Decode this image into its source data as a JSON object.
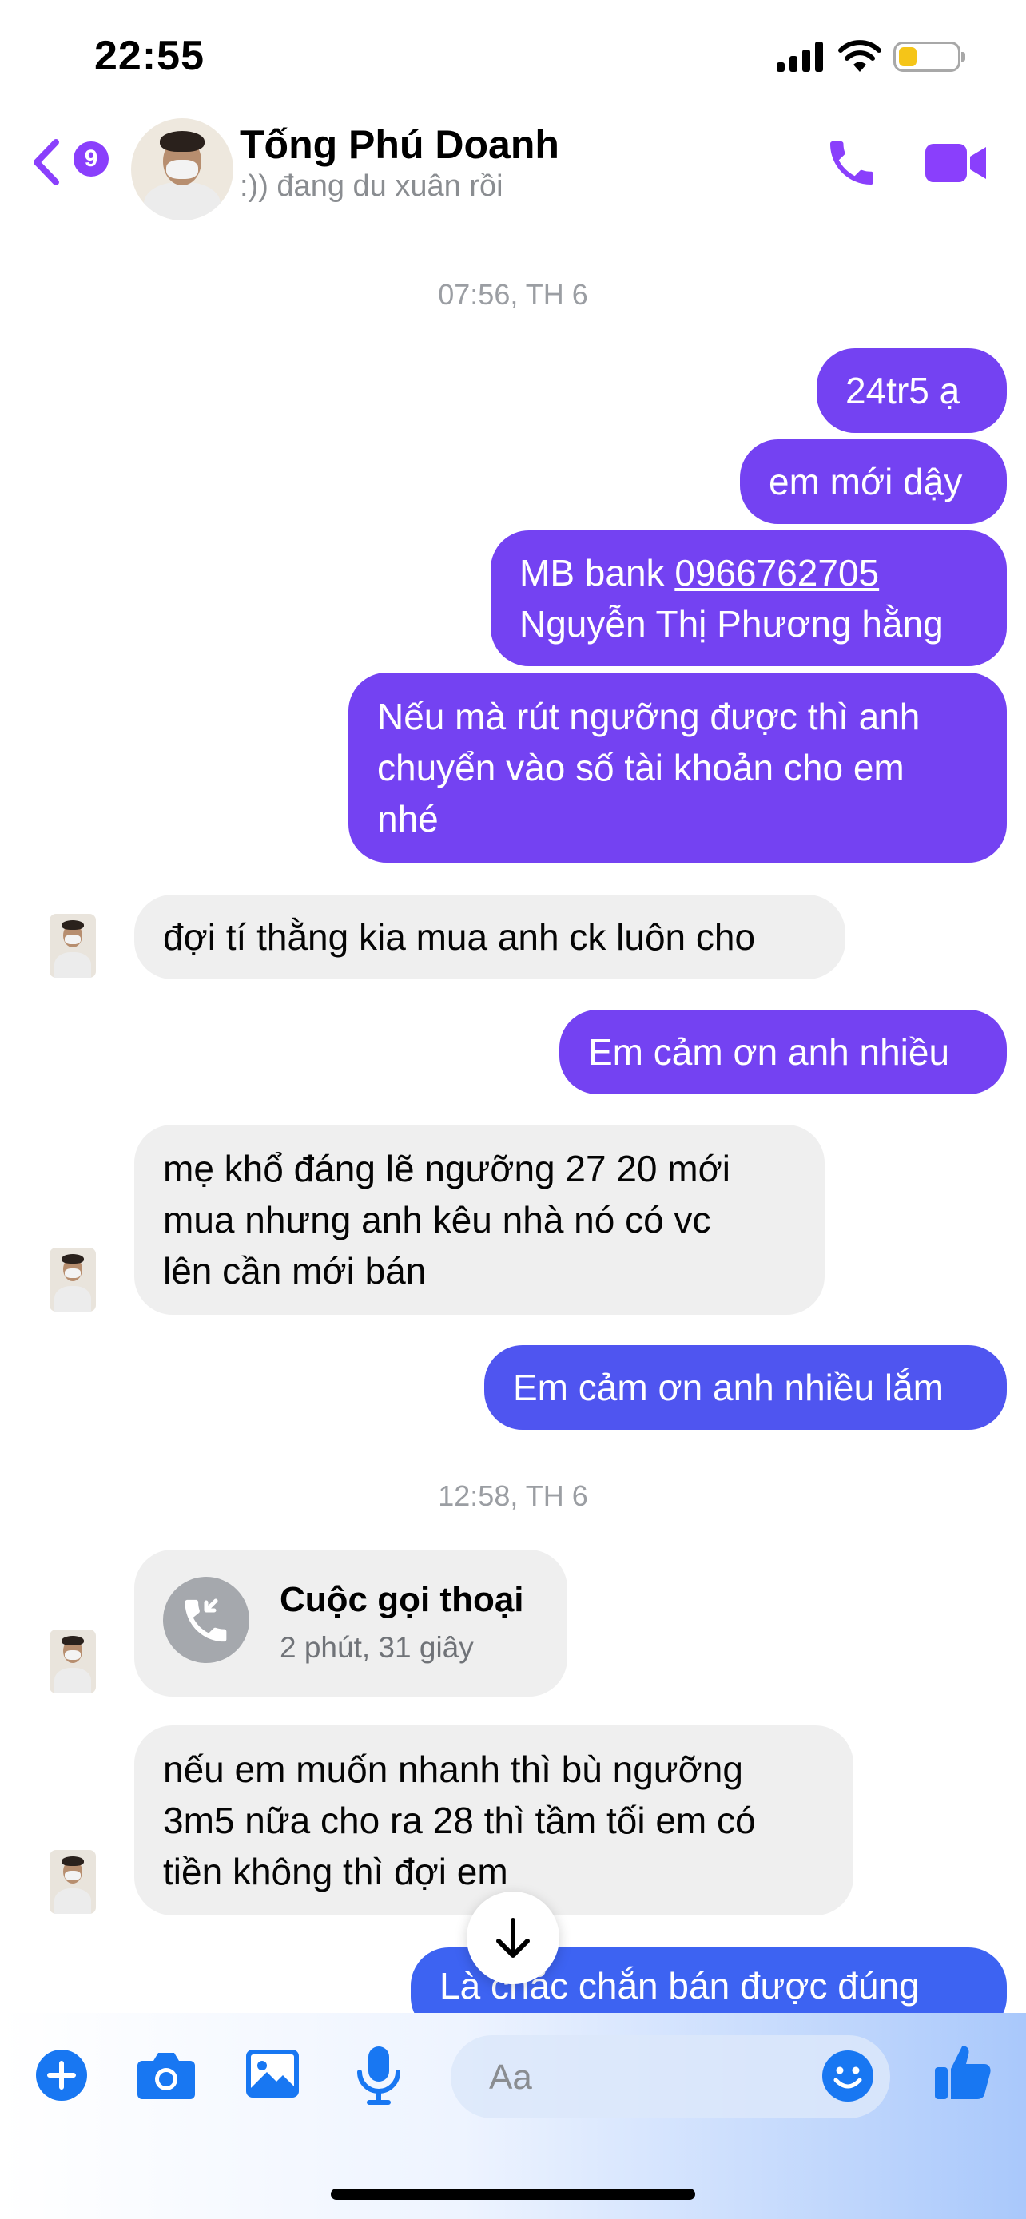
{
  "status_bar": {
    "time": "22:55"
  },
  "header": {
    "back_count": "9",
    "contact_name": "Tống Phú Doanh",
    "contact_status": ":)) đang du xuân rồi"
  },
  "timestamps": [
    "07:56, TH 6",
    "12:58, TH 6"
  ],
  "messages": {
    "m1": "24tr5 ạ",
    "m2": "em mới dậy",
    "m3_line1_prefix": "MB bank ",
    "m3_phone": "0966762705",
    "m3_line2": "Nguyễn Thị Phương hằng",
    "m4_line1": "Nếu mà rút ngưỡng được thì anh",
    "m4_line2": "chuyển vào số tài khoản cho em",
    "m4_line3": "nhé",
    "m5": "đợi tí thằng kia mua anh ck luôn cho",
    "m6": "Em cảm ơn anh nhiều",
    "m7_line1": "mẹ khổ đáng lẽ ngưỡng 27 20 mới",
    "m7_line2": "mua nhưng anh kêu nhà nó có vc",
    "m7_line3": "lên cần mới bán",
    "m8": "Em cảm ơn anh nhiều lắm",
    "m9_line1": "nếu em muốn nhanh thì bù ngưỡng",
    "m9_line2": "3m5 nữa cho ra 28 thì tầm tối em có",
    "m9_line3": "tiền không thì đợi em",
    "m10": "Là chắc chắn bán được đúng"
  },
  "call": {
    "title": "Cuộc gọi thoại",
    "duration": "2 phút, 31 giây"
  },
  "composer": {
    "placeholder": "Aa"
  },
  "colors": {
    "accent": "#8a3ffc",
    "outgoing_bubble": "#7442f2",
    "incoming_bubble": "#efefef",
    "composer_icons": "#1877f2"
  },
  "icons": [
    "back-chevron-icon",
    "phone-icon",
    "video-camera-icon",
    "plus-icon",
    "camera-icon",
    "image-icon",
    "microphone-icon",
    "emoji-icon",
    "thumbs-up-icon",
    "missed-call-icon",
    "arrow-down-icon"
  ]
}
